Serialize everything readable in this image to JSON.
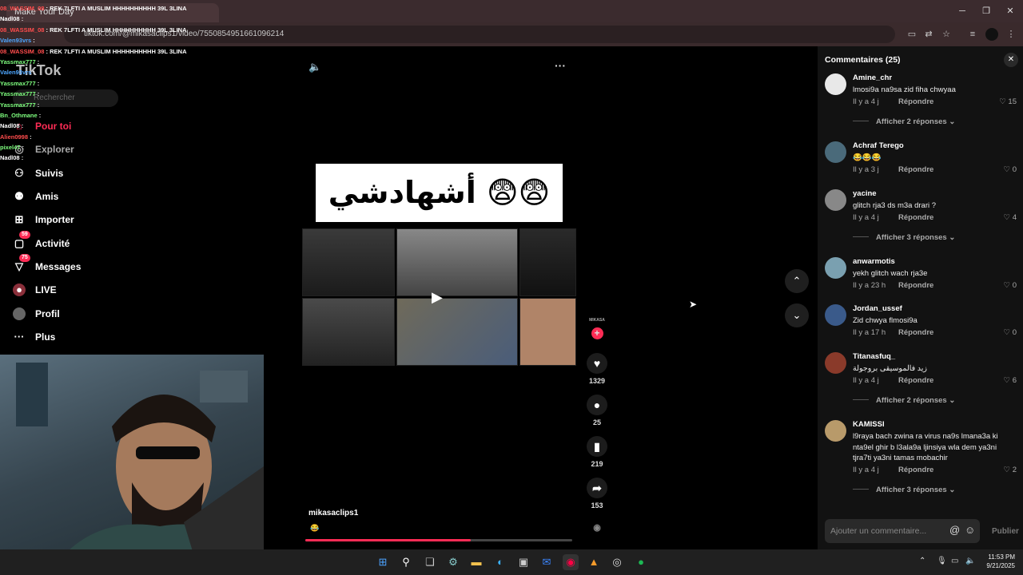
{
  "browser": {
    "tab_title": "Make Your Day",
    "url": "tiktok.com/@mikasaclips1/video/7550854951661096214",
    "icons": [
      "cast-icon",
      "translate-icon",
      "star-icon",
      "extensions-icon",
      "profile-icon",
      "menu-icon"
    ]
  },
  "chat": [
    {
      "user": "08_WASSIM_08",
      "msg": "REK 7LFTI A MUSLIM HHHHHHHHHH 39L 3LINA",
      "color": "#ff4d4d"
    },
    {
      "user": "Nadl08",
      "msg": "",
      "color": "#ffffff"
    },
    {
      "user": "08_WASSIM_08",
      "msg": "REK 7LFTI A MUSLIM HHHHHHHHHH 39L 3LINA",
      "color": "#ff4d4d"
    },
    {
      "user": "Valen93vrs",
      "msg": "",
      "color": "#4da6ff"
    },
    {
      "user": "08_WASSIM_08",
      "msg": "REK 7LFTI A MUSLIM HHHHHHHHHH 39L 3LINA",
      "color": "#ff4d4d"
    },
    {
      "user": "Yassmax777",
      "msg": "",
      "color": "#7fff7f"
    },
    {
      "user": "Valen93vrs",
      "msg": "",
      "color": "#4da6ff"
    },
    {
      "user": "Yassmax777",
      "msg": "",
      "color": "#7fff7f"
    },
    {
      "user": "Yassmax777",
      "msg": "",
      "color": "#7fff7f"
    },
    {
      "user": "Yassmax777",
      "msg": "",
      "color": "#7fff7f"
    },
    {
      "user": "Bn_Othmane",
      "msg": "",
      "color": "#7fff7f"
    },
    {
      "user": "Nadl08",
      "msg": "",
      "color": "#ffffff"
    },
    {
      "user": "Alien0998",
      "msg": "",
      "color": "#ff4d4d"
    },
    {
      "user": "pixel47",
      "msg": "",
      "color": "#7fff7f"
    },
    {
      "user": "Nadl08",
      "msg": "",
      "color": "#ffffff"
    }
  ],
  "tiktok_nav": {
    "logo": "TikTok",
    "search_placeholder": "Rechercher",
    "items": [
      {
        "label": "Pour toi",
        "icon": "home-icon"
      },
      {
        "label": "Explorer",
        "icon": "compass-icon"
      },
      {
        "label": "Suivis",
        "icon": "following-icon"
      },
      {
        "label": "Amis",
        "icon": "friends-icon"
      },
      {
        "label": "Importer",
        "icon": "upload-icon"
      },
      {
        "label": "Activité",
        "icon": "bell-icon",
        "badge": "59"
      },
      {
        "label": "Messages",
        "icon": "messages-icon",
        "badge": "75"
      },
      {
        "label": "LIVE",
        "icon": "live-icon"
      },
      {
        "label": "Profil",
        "icon": "profile-icon"
      },
      {
        "label": "Plus",
        "icon": "more-icon"
      }
    ]
  },
  "video": {
    "overlay_title": "أشهادشي 😨😨",
    "author": "mikasaclips1",
    "progress": 0.62,
    "likes": "1329",
    "comments": "25",
    "saves": "219",
    "shares": "153"
  },
  "comments_panel": {
    "title": "Commentaires (25)",
    "input_placeholder": "Ajouter un commentaire...",
    "post_label": "Publier",
    "reply_label": "Répondre",
    "items": [
      {
        "name": "Amine_chr",
        "text": "lmosi9a na9sa zid fiha chwyaa",
        "time": "Il y a 4 j",
        "likes": "15",
        "more": "Afficher 2 réponses"
      },
      {
        "name": "Achraf Terego",
        "text": "😂😂😂",
        "time": "Il y a 3 j",
        "likes": "0",
        "more": ""
      },
      {
        "name": "yacine",
        "text": "glitch rja3 ds m3a drari ?",
        "time": "Il y a 4 j",
        "likes": "4",
        "more": "Afficher 3 réponses"
      },
      {
        "name": "anwarmotis",
        "text": "yekh glitch wach rja3e",
        "time": "Il y a 23 h",
        "likes": "0",
        "more": ""
      },
      {
        "name": "Jordan_ussef",
        "text": "Zid chwya flmosi9a",
        "time": "Il y a 17 h",
        "likes": "0",
        "more": ""
      },
      {
        "name": "Titanasfuq_",
        "text": "زيد فالموسيقى بروجولة",
        "time": "Il y a 4 j",
        "likes": "6",
        "more": "Afficher 2 réponses"
      },
      {
        "name": "KAMISSI",
        "text": "l9raya bach zwina ra virus na9s lmana3a ki nta9el ghir b l3ala9a ljinsiya wla dem ya3ni tjra7ti ya3ni tamas mobachir",
        "time": "Il y a 4 j",
        "likes": "2",
        "more": "Afficher 3 réponses"
      }
    ]
  },
  "taskbar": {
    "time": "11:53 PM",
    "date": "9/21/2025"
  }
}
